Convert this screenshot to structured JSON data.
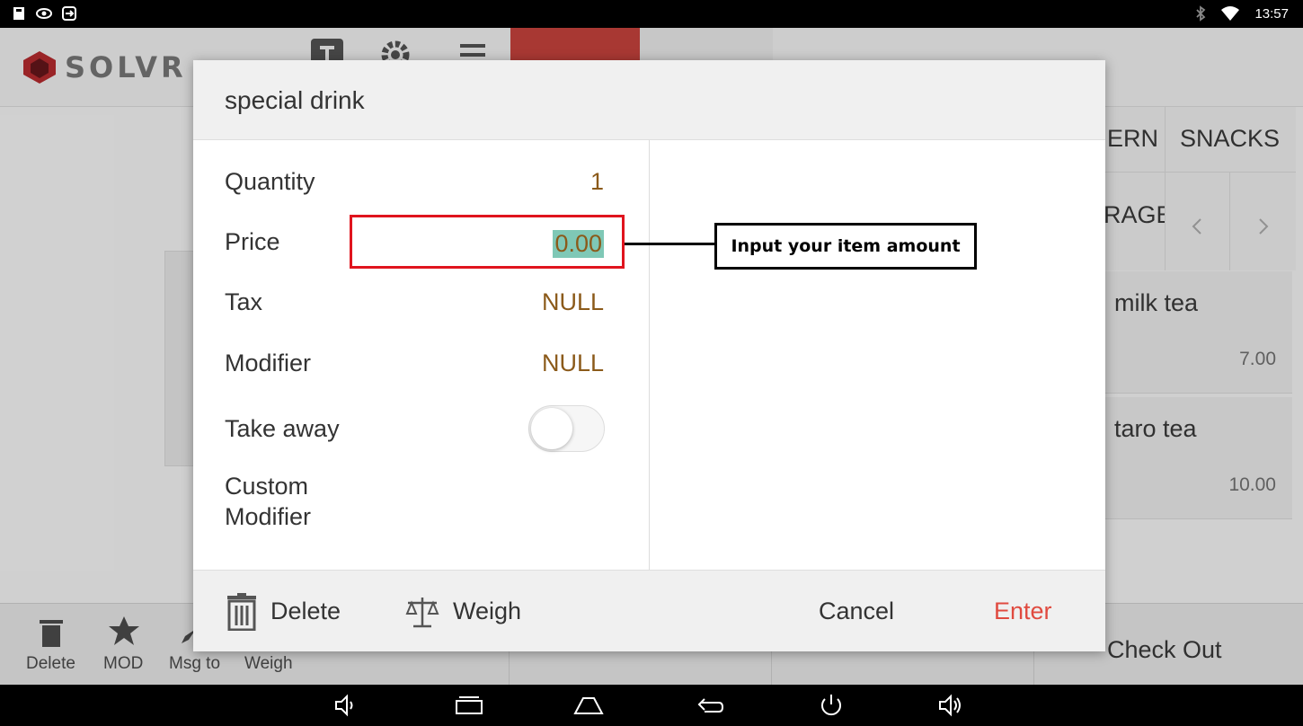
{
  "status_bar": {
    "time": "13:57"
  },
  "app": {
    "logo": "SOLVR",
    "categories": [
      "ERN",
      "SNACKS",
      "RAGE"
    ],
    "items": [
      {
        "name": "milk tea",
        "price": "7.00"
      },
      {
        "name": "taro tea",
        "price": "10.00"
      }
    ],
    "bottom_bar": {
      "delete": "Delete",
      "mod": "MOD",
      "msg_to": "Msg to",
      "weigh": "Weigh",
      "check_out": "Check Out"
    }
  },
  "dialog": {
    "title": "special drink",
    "rows": {
      "quantity": {
        "label": "Quantity",
        "value": "1"
      },
      "price": {
        "label": "Price",
        "value": "0.00"
      },
      "tax": {
        "label": "Tax",
        "value": "NULL"
      },
      "modifier": {
        "label": "Modifier",
        "value": "NULL"
      },
      "take_away": {
        "label": "Take away",
        "enabled": false
      },
      "custom_modifier": {
        "label": "Custom\nModifier"
      }
    },
    "footer": {
      "delete": "Delete",
      "weigh": "Weigh",
      "cancel": "Cancel",
      "enter": "Enter"
    }
  },
  "callout": {
    "text": "Input your item amount"
  },
  "colors": {
    "accent_red": "#b23b36",
    "enter_red": "#e04a3f",
    "value_brown": "#8b5a1a",
    "highlight_teal": "#7fc8b6",
    "callout_border": "#e0141e"
  }
}
